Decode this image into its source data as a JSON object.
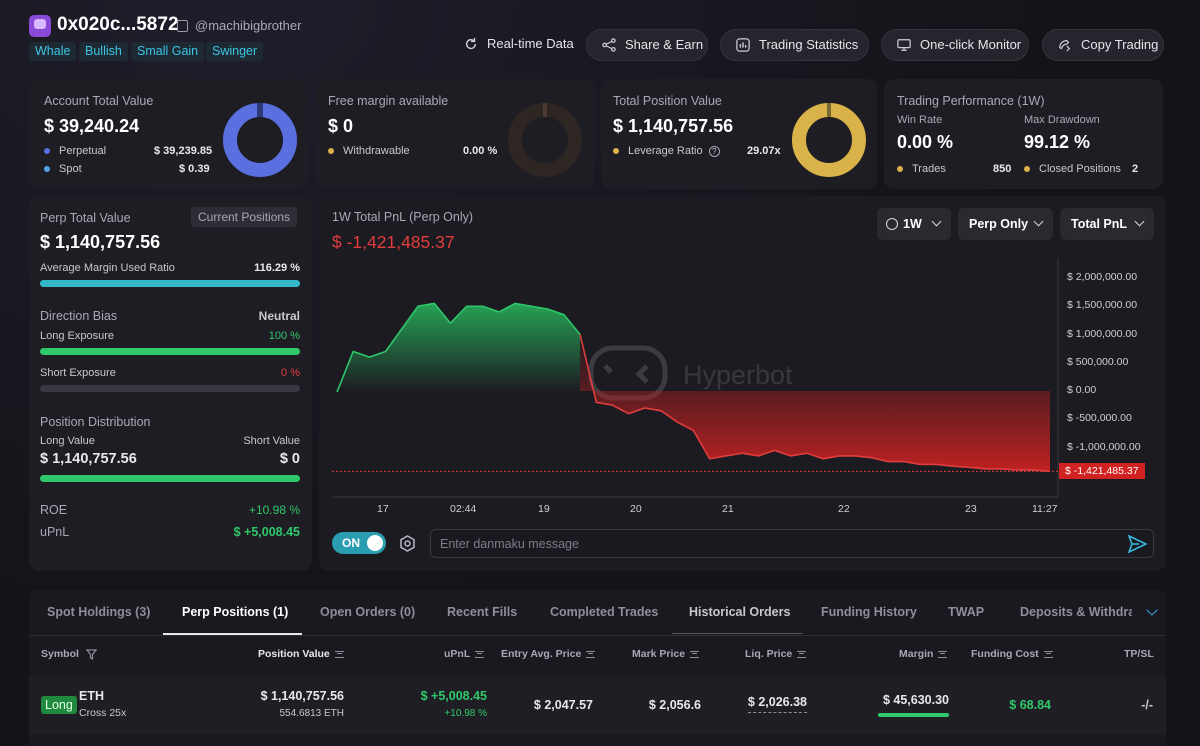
{
  "header": {
    "address": "0x020c...5872",
    "handle": "@machibigbrother",
    "tags": [
      "Whale",
      "Bullish",
      "Small Gain",
      "Swinger"
    ],
    "buttons": [
      "Real-time Data",
      "Share & Earn",
      "Trading Statistics",
      "One-click Monitor",
      "Copy Trading"
    ]
  },
  "account": {
    "title": "Account Total Value",
    "value": "$ 39,240.24",
    "rows": [
      {
        "label": "Perpetual",
        "value": "$ 39,239.85",
        "color": "#5a6fe0"
      },
      {
        "label": "Spot",
        "value": "$ 0.39",
        "color": "#4fa4e8"
      }
    ]
  },
  "margin": {
    "title": "Free margin available",
    "value": "$ 0",
    "row_label": "Withdrawable",
    "row_value": "0.00 %",
    "color": "#d9b34a"
  },
  "position": {
    "title": "Total Position Value",
    "value": "$ 1,140,757.56",
    "row_label": "Leverage Ratio",
    "row_value": "29.07x",
    "color": "#d9b34a"
  },
  "performance": {
    "title": "Trading Performance (1W)",
    "win_rate_label": "Win Rate",
    "win_rate": "0.00 %",
    "drawdown_label": "Max Drawdown",
    "drawdown": "99.12 %",
    "trades_label": "Trades",
    "trades": "850",
    "closed_label": "Closed Positions",
    "closed": "2"
  },
  "perp": {
    "title": "Perp Total Value",
    "current_positions": "Current Positions",
    "value": "$ 1,140,757.56",
    "avg_margin_label": "Average Margin Used Ratio",
    "avg_margin": "116.29 %",
    "avg_margin_fill": 1.0,
    "bias_label": "Direction Bias",
    "bias": "Neutral",
    "long_label": "Long Exposure",
    "long_value": "100 %",
    "long_fill": 1.0,
    "short_label": "Short Exposure",
    "short_value": "0 %",
    "short_fill": 0.0,
    "dist_label": "Position Distribution",
    "long_value_label": "Long Value",
    "short_value_label": "Short Value",
    "long_amount": "$ 1,140,757.56",
    "short_amount": "$ 0",
    "roe_label": "ROE",
    "roe": "+10.98 %",
    "upnl_label": "uPnL",
    "upnl": "$ +5,008.45"
  },
  "pnl_chart": {
    "title": "1W Total PnL (Perp Only)",
    "value": "$ -1,421,485.37",
    "filters": [
      "1W",
      "Perp Only",
      "Total PnL"
    ],
    "watermark": "Hyperbot",
    "danmaku_toggle": "ON",
    "danmaku_placeholder": "Enter danmaku message"
  },
  "chart_data": {
    "type": "area",
    "title": "1W Total PnL (Perp Only)",
    "y_ticks": [
      "$ 2,000,000.00",
      "$ 1,500,000.00",
      "$ 1,000,000.00",
      "$ 500,000.00",
      "$ 0.00",
      "$ -500,000.00",
      "$ -1,000,000.00"
    ],
    "ylim": [
      -1600000,
      2200000
    ],
    "x_ticks": [
      "17",
      "02:44",
      "19",
      "20",
      "21",
      "22",
      "23",
      "11:27"
    ],
    "last_label": "$ -1,421,485.37",
    "series": [
      {
        "values": [
          -20000,
          700000,
          600000,
          700000,
          1100000,
          1500000,
          1550000,
          1200000,
          1500000,
          1500000,
          1400000,
          1550000,
          1500000,
          1450000,
          1350000,
          1000000,
          -200000,
          -250000,
          -400000,
          -300000,
          -350000,
          -550000,
          -700000,
          -1200000,
          -1150000,
          -1100000,
          -1150000,
          -1050000,
          -1150000,
          -1100000,
          -1200000,
          -1150000,
          -1150000,
          -1180000,
          -1250000,
          -1250000,
          -1300000,
          -1300000,
          -1330000,
          -1350000,
          -1380000,
          -1380000,
          -1400000,
          -1400000,
          -1421485
        ]
      }
    ]
  },
  "tabs": [
    "Spot Holdings (3)",
    "Perp Positions (1)",
    "Open Orders (0)",
    "Recent Fills",
    "Completed Trades",
    "Historical Orders",
    "Funding History",
    "TWAP",
    "Deposits & Withdraw"
  ],
  "table": {
    "headers": [
      "Symbol",
      "Position Value",
      "uPnL",
      "Entry Avg. Price",
      "Mark Price",
      "Liq. Price",
      "Margin",
      "Funding Cost",
      "TP/SL"
    ],
    "row": {
      "side": "Long",
      "symbol": "ETH",
      "mode": "Cross 25x",
      "position_value": "$ 1,140,757.56",
      "position_size": "554.6813 ETH",
      "upnl": "$ +5,008.45",
      "upnl_pct": "+10.98 %",
      "entry": "$ 2,047.57",
      "mark": "$ 2,056.6",
      "liq": "$ 2,026.38",
      "margin": "$ 45,630.30",
      "funding": "$ 68.84",
      "tpsl": "-/-"
    }
  }
}
